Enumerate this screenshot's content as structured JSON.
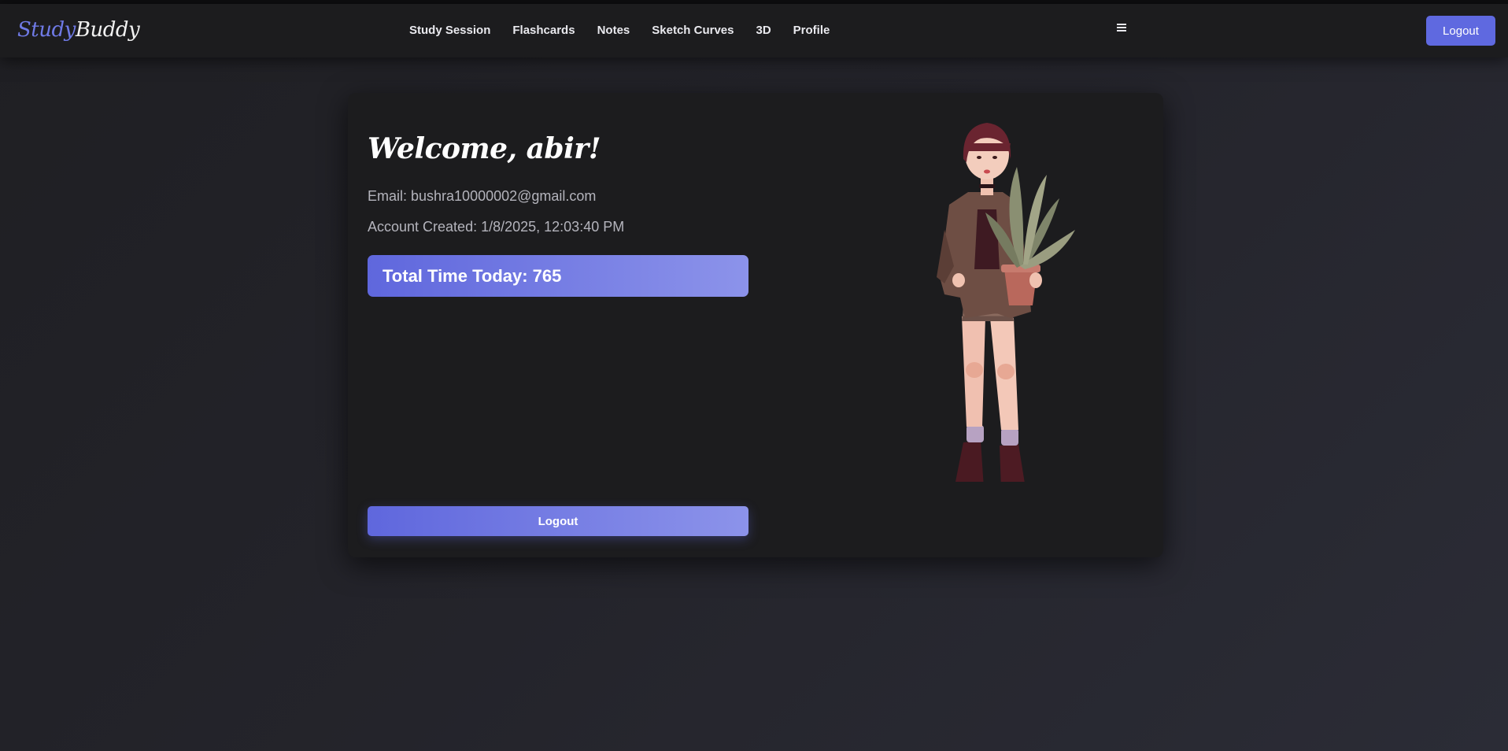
{
  "navbar": {
    "logo_part1": "Study",
    "logo_part2": "Buddy",
    "links": [
      "Study Session",
      "Flashcards",
      "Notes",
      "Sketch Curves",
      "3D",
      "Profile"
    ],
    "menu_icon": "hamburger-menu-icon",
    "logout_label": "Logout"
  },
  "profile": {
    "welcome": "Welcome, abir!",
    "email_line": "Email: bushra10000002@gmail.com",
    "created_line": "Account Created: 1/8/2025, 12:03:40 PM",
    "total_time_line": "Total Time Today: 765",
    "logout_label": "Logout"
  },
  "colors": {
    "accent": "#5f69e0",
    "accent_light": "#8c93ea",
    "card_bg": "#1c1c1e",
    "page_bg": "#24242b"
  }
}
